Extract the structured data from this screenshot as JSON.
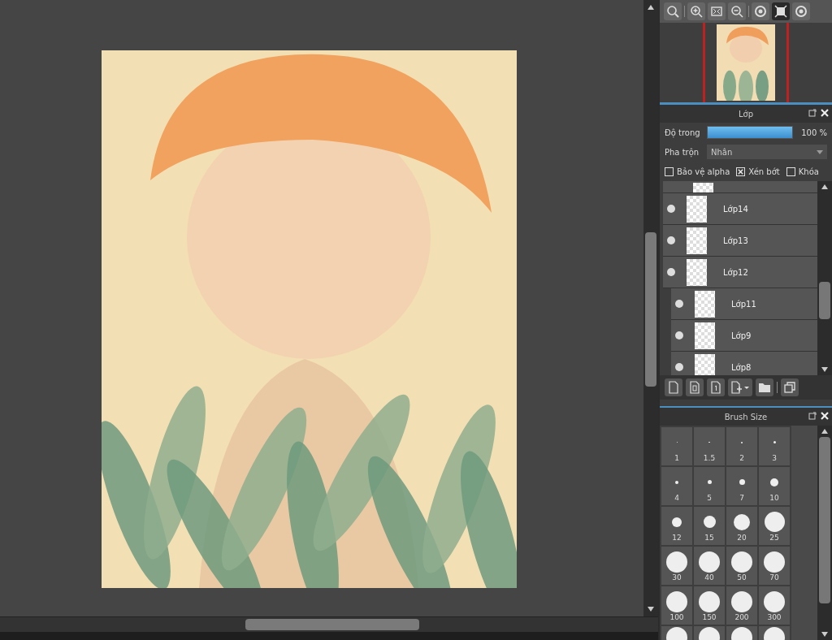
{
  "layer_panel": {
    "title": "Lớp",
    "opacity": {
      "label": "Độ trong",
      "level": 1.0,
      "reading": "100 %"
    },
    "blend": {
      "label": "Pha trộn",
      "value": "Nhân"
    },
    "options": [
      {
        "label": "Bảo vệ alpha",
        "checked": false
      },
      {
        "label": "Xén bớt",
        "checked": true
      },
      {
        "label": "Khóa",
        "checked": false
      }
    ],
    "layers": [
      {
        "name": "Lớp14",
        "visible": true,
        "clipped": false
      },
      {
        "name": "Lớp13",
        "visible": true,
        "clipped": false
      },
      {
        "name": "Lớp12",
        "visible": true,
        "clipped": false
      },
      {
        "name": "Lớp11",
        "visible": true,
        "clipped": true
      },
      {
        "name": "Lớp9",
        "visible": true,
        "clipped": true
      },
      {
        "name": "Lớp8",
        "visible": true,
        "clipped": true
      }
    ]
  },
  "brush_panel": {
    "title": "Brush Size",
    "sizes": [
      "1",
      "1.5",
      "2",
      "3",
      "4",
      "5",
      "7",
      "10",
      "12",
      "15",
      "20",
      "25",
      "30",
      "40",
      "50",
      "70",
      "100",
      "150",
      "200",
      "300"
    ]
  }
}
